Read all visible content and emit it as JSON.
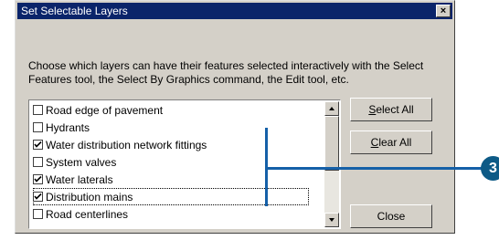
{
  "window": {
    "title": "Set Selectable Layers",
    "close_glyph": "×"
  },
  "instructions": "Choose which layers can have their features selected interactively with the Select Features tool, the Select By Graphics command, the Edit tool, etc.",
  "layers": [
    {
      "label": "Road  edge of pavement",
      "checked": false
    },
    {
      "label": "Hydrants",
      "checked": false
    },
    {
      "label": "Water distribution network fittings",
      "checked": true
    },
    {
      "label": "System valves",
      "checked": false
    },
    {
      "label": "Water laterals",
      "checked": true
    },
    {
      "label": "Distribution mains",
      "checked": true,
      "focused": true
    },
    {
      "label": "Road centerlines",
      "checked": false
    }
  ],
  "buttons": {
    "select_all_prefix": "S",
    "select_all_rest": "elect All",
    "clear_all_prefix": "C",
    "clear_all_rest": "lear All",
    "close": "Close"
  },
  "callout": {
    "number": "3",
    "color": "#0d5a86"
  }
}
